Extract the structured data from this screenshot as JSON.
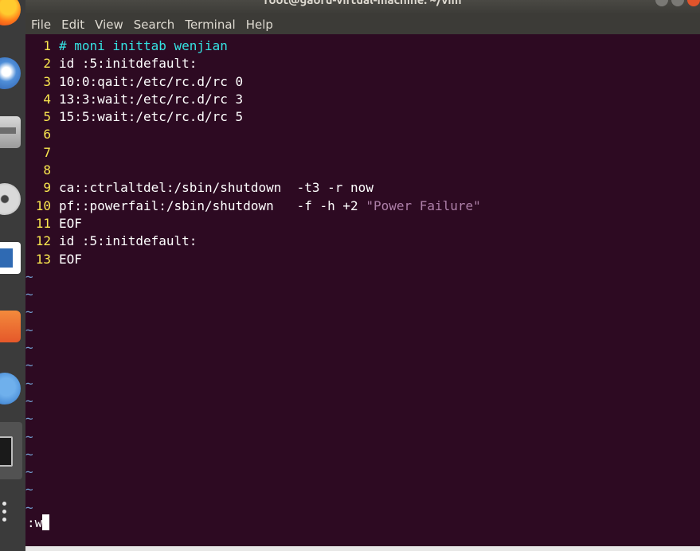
{
  "window": {
    "title": "root@gaoru-virtual-machine: ~/vim"
  },
  "menubar": {
    "items": [
      "File",
      "Edit",
      "View",
      "Search",
      "Terminal",
      "Help"
    ]
  },
  "dock": {
    "icons": [
      "firefox-icon",
      "thunderbird-icon",
      "files-icon",
      "rhythmbox-icon",
      "libreoffice-writer-icon",
      "ubuntu-software-icon",
      "help-icon",
      "terminal-icon",
      "show-applications-icon"
    ]
  },
  "editor": {
    "lines": [
      {
        "num": "1",
        "text": "",
        "comment": "# moni inittab wenjian",
        "string": ""
      },
      {
        "num": "2",
        "text": "id :5:initdefault:",
        "comment": "",
        "string": ""
      },
      {
        "num": "3",
        "text": "10:0:qait:/etc/rc.d/rc 0",
        "comment": "",
        "string": ""
      },
      {
        "num": "4",
        "text": "13:3:wait:/etc/rc.d/rc 3",
        "comment": "",
        "string": ""
      },
      {
        "num": "5",
        "text": "15:5:wait:/etc/rc.d/rc 5",
        "comment": "",
        "string": ""
      },
      {
        "num": "6",
        "text": "",
        "comment": "",
        "string": ""
      },
      {
        "num": "7",
        "text": "",
        "comment": "",
        "string": ""
      },
      {
        "num": "8",
        "text": "",
        "comment": "",
        "string": ""
      },
      {
        "num": "9",
        "text": "ca::ctrlaltdel:/sbin/shutdown  -t3 -r now",
        "comment": "",
        "string": ""
      },
      {
        "num": "10",
        "text": "pf::powerfail:/sbin/shutdown   -f -h +2 ",
        "comment": "",
        "string": "\"Power Failure\""
      },
      {
        "num": "11",
        "text": "EOF",
        "comment": "",
        "string": ""
      },
      {
        "num": "12",
        "text": "id :5:initdefault:",
        "comment": "",
        "string": ""
      },
      {
        "num": "13",
        "text": "EOF",
        "comment": "",
        "string": ""
      }
    ],
    "tilde_count": 14,
    "tilde_char": "~",
    "command_line": ":w"
  },
  "colors": {
    "terminal_bg": "#2d0a22",
    "line_number": "#fce94f",
    "comment": "#34e2e2",
    "string": "#ad7fa8",
    "tilde": "#729fcf"
  }
}
